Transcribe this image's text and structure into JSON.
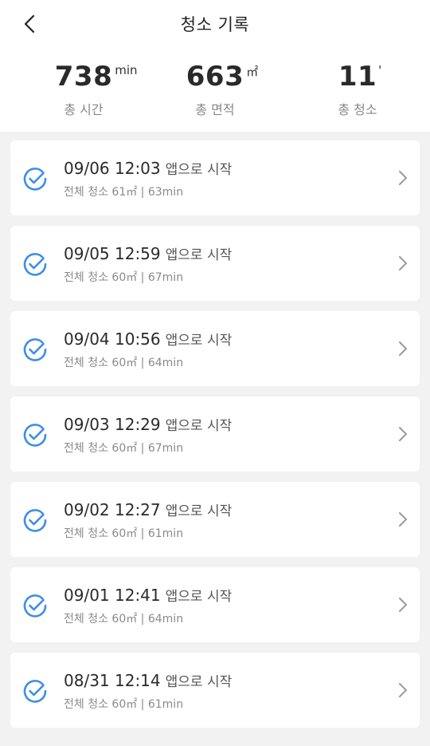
{
  "header": {
    "title": "청소 기록"
  },
  "stats": [
    {
      "value": "738",
      "unit": "min",
      "label": "총 시간"
    },
    {
      "value": "663",
      "unit": "㎡",
      "label": "총 면적"
    },
    {
      "value": "11",
      "unit": "'",
      "label": "총 청소"
    }
  ],
  "records": [
    {
      "datetime": "09/06 12:03",
      "source": "앱으로 시작",
      "detail": "전체 청소 61㎡ | 63min"
    },
    {
      "datetime": "09/05 12:59",
      "source": "앱으로 시작",
      "detail": "전체 청소 60㎡ | 67min"
    },
    {
      "datetime": "09/04 10:56",
      "source": "앱으로 시작",
      "detail": "전체 청소 60㎡ | 64min"
    },
    {
      "datetime": "09/03 12:29",
      "source": "앱으로 시작",
      "detail": "전체 청소 60㎡ | 67min"
    },
    {
      "datetime": "09/02 12:27",
      "source": "앱으로 시작",
      "detail": "전체 청소 60㎡ | 61min"
    },
    {
      "datetime": "09/01 12:41",
      "source": "앱으로 시작",
      "detail": "전체 청소 60㎡ | 64min"
    },
    {
      "datetime": "08/31 12:14",
      "source": "앱으로 시작",
      "detail": "전체 청소 60㎡ | 61min"
    }
  ],
  "icons": {
    "back": "chevron-left-icon",
    "status": "check-circle-icon",
    "row": "chevron-right-icon"
  },
  "colors": {
    "accent": "#3d8ee8",
    "background": "#f2f2f2",
    "card": "#ffffff"
  }
}
